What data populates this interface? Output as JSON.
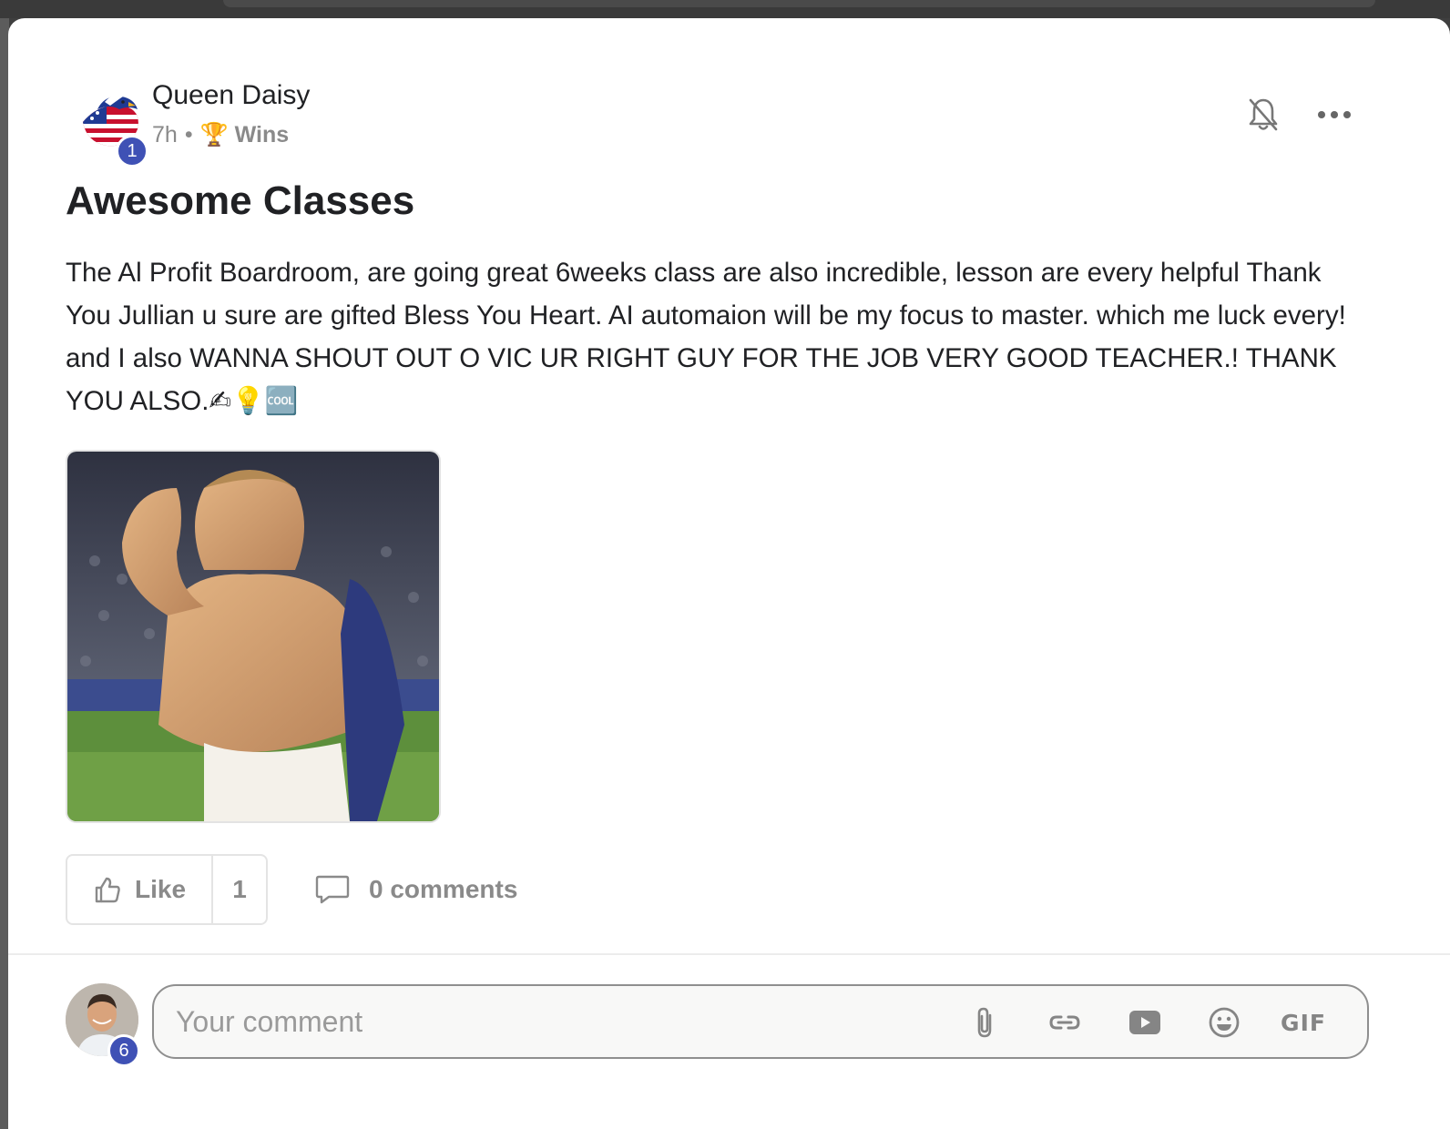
{
  "post": {
    "author": {
      "name": "Queen Daisy",
      "level": "1",
      "avatar_icon": "eagle-flag-avatar-icon"
    },
    "time": "7h",
    "separator": "•",
    "category": {
      "icon": "trophy-icon",
      "emoji": "🏆",
      "label": "Wins"
    },
    "title": "Awesome Classes",
    "body": "The Al Profit Boardroom, are going great 6weeks class are also incredible, lesson are every helpful Thank You Jullian u sure are gifted Bless You Heart. AI automaion will be my focus to master. which me luck every! and I also WANNA SHOUT OUT O VIC UR RIGHT GUY FOR THE JOB VERY GOOD TEACHER.! THANK YOU ALSO.✍💡🆒",
    "image_alt": "celebrating soccer player gif"
  },
  "actions": {
    "like_label": "Like",
    "like_count": "1",
    "comments_label": "0 comments"
  },
  "composer": {
    "user_level": "6",
    "placeholder": "Your comment",
    "gif_label": "GIF"
  },
  "colors": {
    "badge": "#3f51b5",
    "muted": "#8a8a8a",
    "text": "#202124"
  }
}
